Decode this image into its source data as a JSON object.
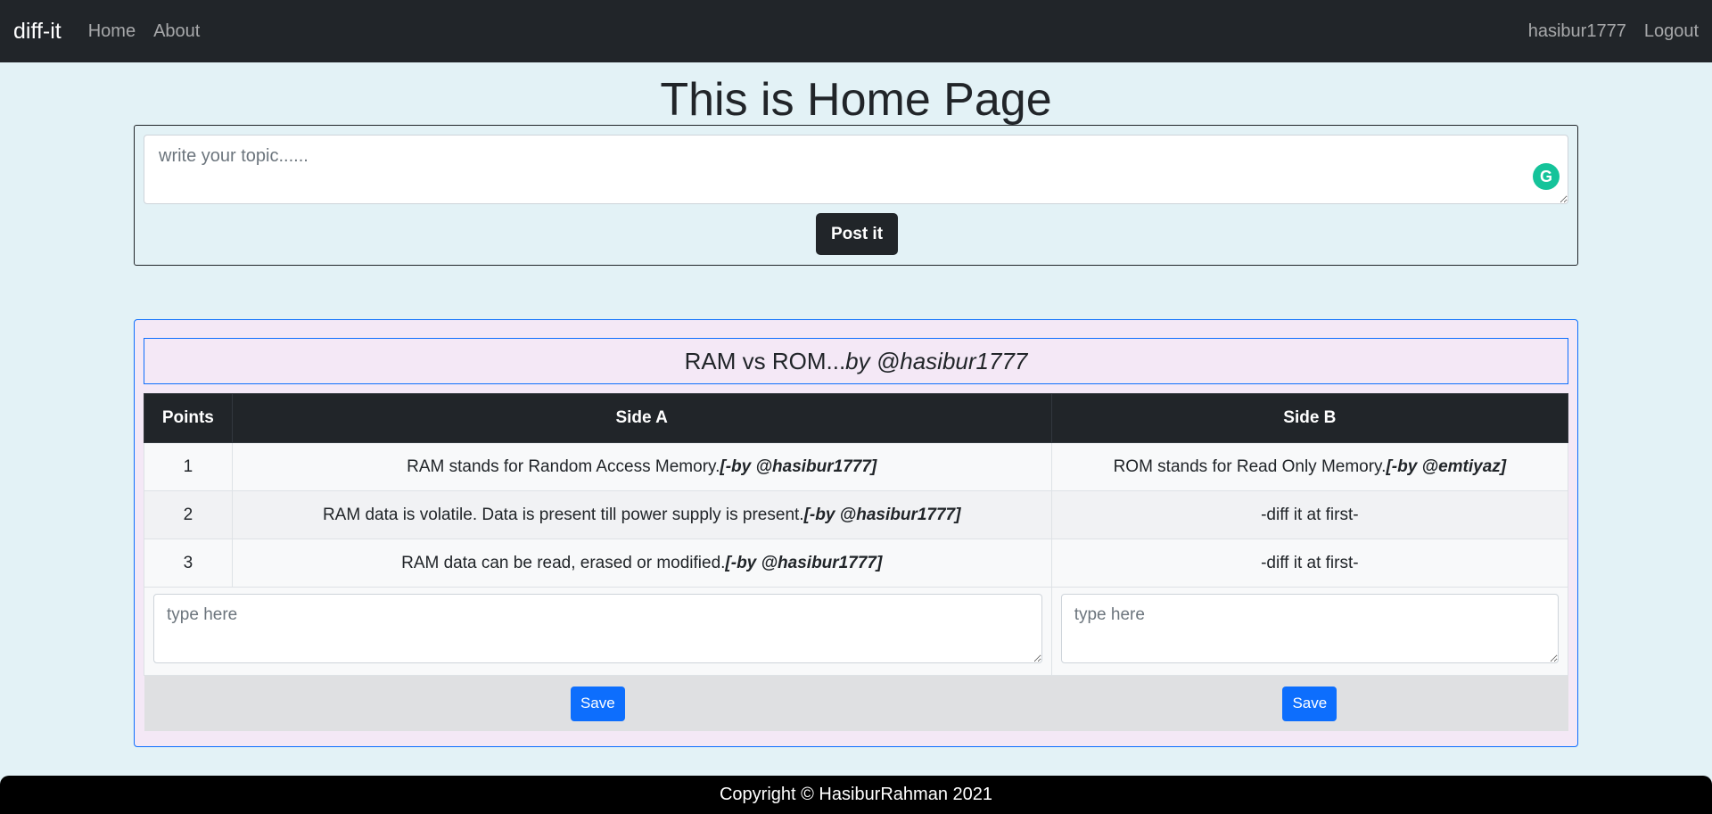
{
  "nav": {
    "brand": "diff-it",
    "links": [
      "Home",
      "About"
    ],
    "user": "hasibur1777",
    "logout": "Logout"
  },
  "page_title": "This is Home Page",
  "post": {
    "placeholder": "write your topic......",
    "button": "Post it"
  },
  "topic": {
    "title": "RAM vs ROM...",
    "author": "by @hasibur1777"
  },
  "table": {
    "headers": [
      "Points",
      "Side A",
      "Side B"
    ],
    "rows": [
      {
        "point": "1",
        "a_text": "RAM stands for Random Access Memory.",
        "a_by": "[-by @hasibur1777]",
        "b_text": "ROM stands for Read Only Memory.",
        "b_by": "[-by @emtiyaz]"
      },
      {
        "point": "2",
        "a_text": "RAM data is volatile. Data is present till power supply is present.",
        "a_by": "[-by @hasibur1777]",
        "b_text": "-diff it at first-",
        "b_by": ""
      },
      {
        "point": "3",
        "a_text": "RAM data can be read, erased or modified.",
        "a_by": "[-by @hasibur1777]",
        "b_text": "-diff it at first-",
        "b_by": ""
      }
    ],
    "input_placeholder_a": "type here",
    "input_placeholder_b": "type here",
    "save_a": "Save",
    "save_b": "Save"
  },
  "footer": "Copyright © HasiburRahman 2021",
  "colors": {
    "navbar": "#212529",
    "background": "#e3f2f6",
    "card_background": "#f4e8f6",
    "primary": "#0d6efd",
    "grammarly": "#15c39a"
  },
  "icons": [
    "grammarly-icon"
  ]
}
